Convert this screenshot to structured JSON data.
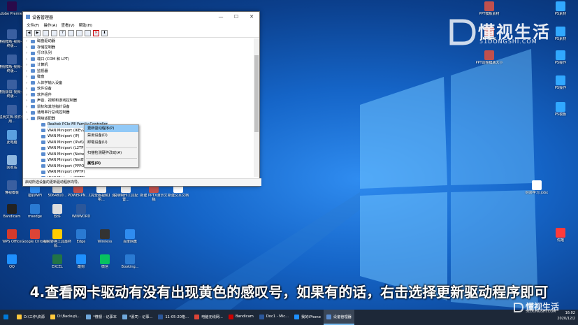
{
  "desktop_icons_left": [
    {
      "label": "Adobe Premie...",
      "color": "#2a0a4a"
    },
    {
      "label": "懂视模板-视频-最终版...",
      "color": "#3a5fa0"
    },
    {
      "label": "懂视模板-视频-最终版...",
      "color": "#3a5fa0"
    },
    {
      "label": "懂视录屏-视频-最终版...",
      "color": "#3a5fa0"
    },
    {
      "label": "说明文档-软件使用...",
      "color": "#3a5fa0"
    },
    {
      "label": "此电脑",
      "color": "#5aa0e0"
    },
    {
      "label": "回收站",
      "color": "#8fb8e0"
    },
    {
      "label": "懂视模板",
      "color": "#3a5fa0"
    },
    {
      "label": "Bandicam",
      "color": "#222222"
    },
    {
      "label": "WPS Office",
      "color": "#d33a2c"
    },
    {
      "label": "QQ",
      "color": "#1e90ff"
    }
  ],
  "desktop_icons_bottom": [
    {
      "label": "猎豹WiFi",
      "color": "#2f8cf0"
    },
    {
      "label": "5064810...",
      "color": "#cccccc"
    },
    {
      "label": "POWERPN...",
      "color": "#c0504d"
    },
    {
      "label": "【完全版视频】说明...",
      "color": "#eeeeee"
    },
    {
      "label": "说明制作工具配置...",
      "color": "#eeeeee"
    },
    {
      "label": "新建 PPTX演示文稿",
      "color": "#c0504d"
    },
    {
      "label": "新建文本文档",
      "color": "#ffffff"
    },
    {
      "label": "msedge",
      "color": "#2a7ad2"
    },
    {
      "label": "软件",
      "color": "#dddddd"
    },
    {
      "label": "WINWORD",
      "color": "#2b579a"
    },
    {
      "label": "Google Chrome",
      "color": "#db4437"
    },
    {
      "label": "视频转换工具最终版...",
      "color": "#ffcc00"
    },
    {
      "label": "Edge",
      "color": "#2a7ad2"
    },
    {
      "label": "Wireless",
      "color": "#333333"
    },
    {
      "label": "百度网盘",
      "color": "#2f8cf0"
    },
    {
      "label": "EXCEL",
      "color": "#217346"
    },
    {
      "label": "酷狗",
      "color": "#1e90ff"
    },
    {
      "label": "微信",
      "color": "#07c160"
    },
    {
      "label": "Booking...",
      "color": "#2a7ad2"
    }
  ],
  "desktop_icons_right": [
    {
      "label": "PPT模板素材",
      "color": "#c0504d"
    },
    {
      "label": "PS素材",
      "color": "#31a8ff"
    },
    {
      "label": "PPT素材",
      "color": "#c0504d"
    },
    {
      "label": "PS素材",
      "color": "#31a8ff"
    },
    {
      "label": "PPT调整模版大小",
      "color": "#c0504d"
    },
    {
      "label": "PS操作",
      "color": "#31a8ff"
    },
    {
      "label": "PS操作",
      "color": "#31a8ff"
    },
    {
      "label": "PS模板",
      "color": "#31a8ff"
    },
    {
      "label": "经验学习.jobx",
      "color": "#ffffff"
    },
    {
      "label": "优酷",
      "color": "#ff3a3a"
    }
  ],
  "window": {
    "title": "设备管理器",
    "menu": [
      "文件(F)",
      "操作(A)",
      "查看(V)",
      "帮助(H)"
    ],
    "tree": [
      {
        "label": "磁盘驱动器",
        "child": false
      },
      {
        "label": "存储控制器",
        "child": false
      },
      {
        "label": "打印队列",
        "child": false
      },
      {
        "label": "端口 (COM 和 LPT)",
        "child": false
      },
      {
        "label": "计算机",
        "child": false
      },
      {
        "label": "监视器",
        "child": false
      },
      {
        "label": "键盘",
        "child": false
      },
      {
        "label": "人体学输入设备",
        "child": false
      },
      {
        "label": "软件设备",
        "child": false
      },
      {
        "label": "软件组件",
        "child": false
      },
      {
        "label": "声音、视频和游戏控制器",
        "child": false
      },
      {
        "label": "鼠标和其他指针设备",
        "child": false
      },
      {
        "label": "通用串行总线控制器",
        "child": false
      },
      {
        "label": "网络适配器",
        "child": false,
        "expanded": true
      },
      {
        "label": "Realtek PCIe FE Family Controller",
        "child": true,
        "selected": true
      },
      {
        "label": "WAN Miniport (IKEv2)",
        "child": true
      },
      {
        "label": "WAN Miniport (IP)",
        "child": true
      },
      {
        "label": "WAN Miniport (IPv6)",
        "child": true
      },
      {
        "label": "WAN Miniport (L2TP)",
        "child": true
      },
      {
        "label": "WAN Miniport (Network Monitor)",
        "child": true
      },
      {
        "label": "WAN Miniport (NetBT)",
        "child": true
      },
      {
        "label": "WAN Miniport (PPPOE)",
        "child": true
      },
      {
        "label": "WAN Miniport (PPTP)",
        "child": true
      },
      {
        "label": "WAN Miniport (SSTP)",
        "child": true
      }
    ],
    "status": "启动所选设备的更新驱动程序向导。"
  },
  "context_menu": {
    "items": [
      "更新驱动程序(P)",
      "禁用设备(D)",
      "卸载设备(U)",
      "扫描检测硬件改动(A)",
      "属性(R)"
    ],
    "highlighted_index": 0
  },
  "subtitle": "4.查看网卡驱动有没有出现黄色的感叹号，如果有的话，右击选择更新驱动程序即可",
  "watermark": {
    "big": "懂视生活",
    "small": "51DONGSHI.COM"
  },
  "watermark_small": {
    "big": "懂视生活",
    "small": "51DONGSHI.COM"
  },
  "taskbar": {
    "items": [
      {
        "label": "",
        "color": "#0078d7"
      },
      {
        "label": "D:\\工作\\资源",
        "color": "#ffc83d"
      },
      {
        "label": "D:\\Backup\\...",
        "color": "#ffc83d"
      },
      {
        "label": "*懂视 - 记事本",
        "color": "#6fa8dc"
      },
      {
        "label": "*素司 - 记事...",
        "color": "#6fa8dc"
      },
      {
        "label": "11-05-20格...",
        "color": "#2b579a"
      },
      {
        "label": "电脑无线网...",
        "color": "#db4437"
      },
      {
        "label": "Bandicam",
        "color": "#cc0000"
      },
      {
        "label": "Doc1 - Mic...",
        "color": "#2b579a"
      },
      {
        "label": "我的iPhone",
        "color": "#1e90ff"
      },
      {
        "label": "设备管理器",
        "color": "#5a8ccf",
        "active": true
      }
    ],
    "time": "16:02",
    "date": "2020/12/2"
  },
  "colors": {
    "accent": "#0078d7",
    "taskbar": "#1d2838",
    "desktop": "#1565c8"
  }
}
